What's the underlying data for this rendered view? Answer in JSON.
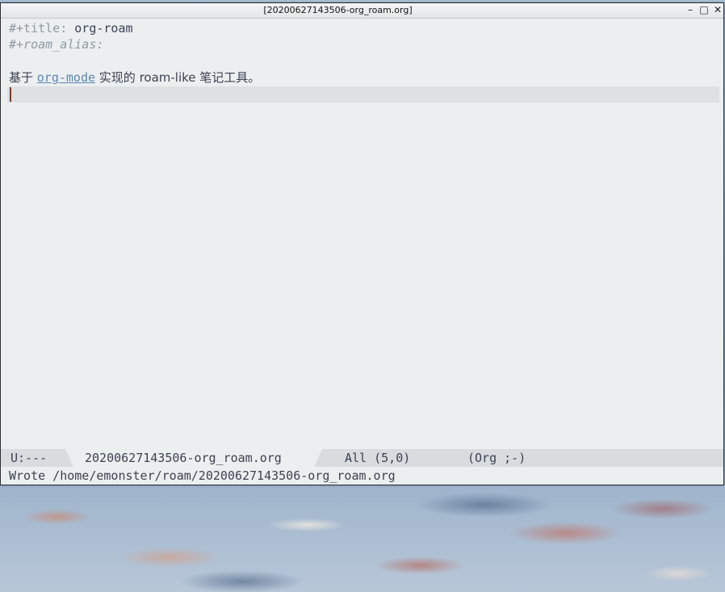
{
  "window": {
    "title": "[20200627143506-org_roam.org]",
    "controls": {
      "minimize": "–",
      "maximize": "□",
      "close": "✕"
    }
  },
  "editor": {
    "lines": [
      {
        "keyword": "#+title:",
        "value": "org-roam"
      },
      {
        "keyword": "#+roam_alias:",
        "value": ""
      },
      {
        "text_before": "基于 ",
        "link": "org-mode",
        "text_after": " 实现的 roam-like 笔记工具。"
      }
    ]
  },
  "modeline": {
    "state": "U:---",
    "buffer": "20200627143506-org_roam.org",
    "position": "All (5,0)",
    "mode": "(Org ;-)"
  },
  "echo_area": {
    "message": "Wrote /home/emonster/roam/20200627143506-org_roam.org"
  },
  "colors": {
    "background": "#eceff0",
    "link": "#5b86b6",
    "keyword": "#8e9aa1",
    "modeline": "#d8dcdf"
  }
}
